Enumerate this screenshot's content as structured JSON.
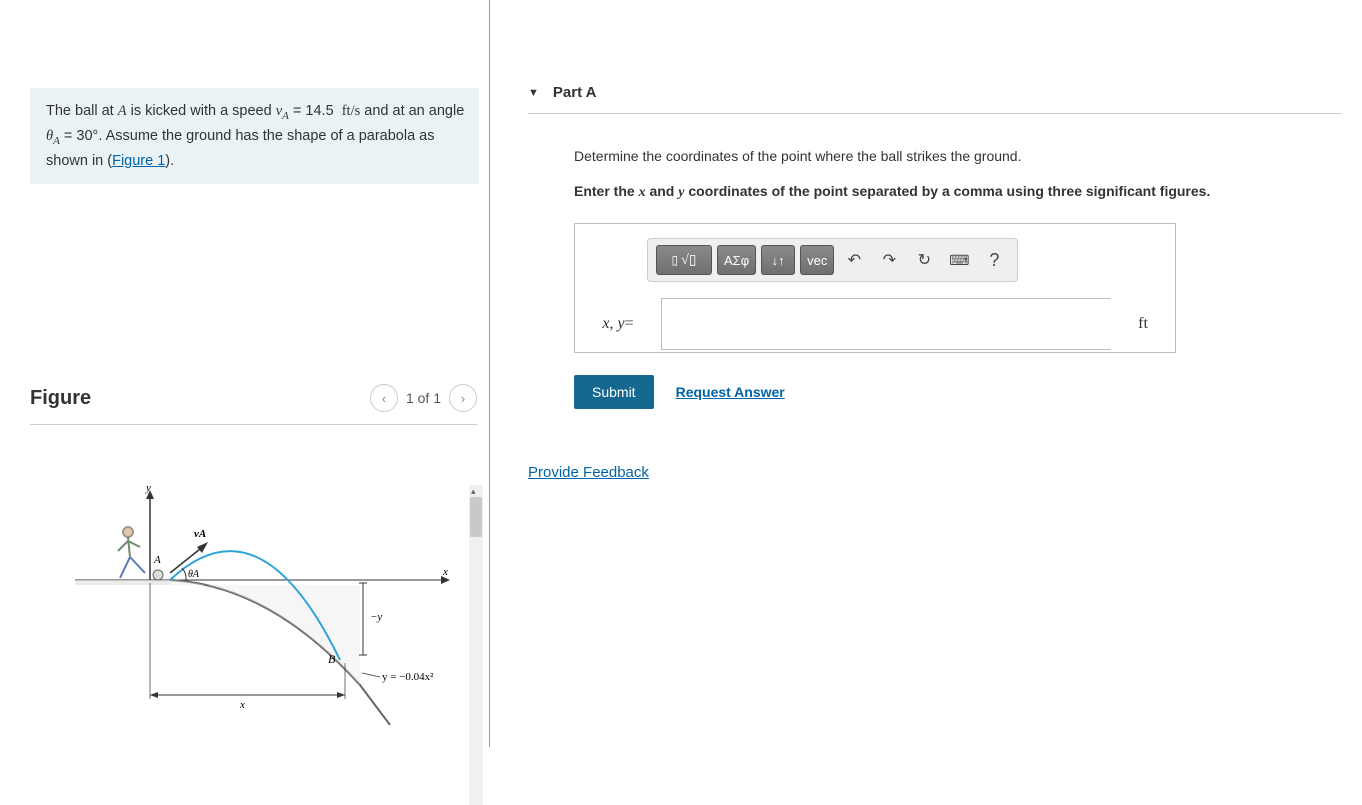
{
  "problem": {
    "speed_value": "14.5",
    "speed_unit": "ft/s",
    "angle_value": "30°",
    "variable_v": "v",
    "subscript_A": "A",
    "variable_theta": "θ",
    "figure_link_text": "Figure 1",
    "text_prefix": "The ball at ",
    "point_A": "A",
    "text_kicked": " is kicked with a speed ",
    "text_and_angle": " and at an angle ",
    "text_assume": ". Assume the ground has the shape of a parabola as shown in (",
    "text_close": ")."
  },
  "figure": {
    "title": "Figure",
    "page_indicator": "1 of 1",
    "labels": {
      "y_axis": "y",
      "x_axis": "x",
      "vA": "vA",
      "A": "A",
      "thetaA": "θA",
      "neg_y": "−y",
      "B": "B",
      "x_dim": "x",
      "equation": "y = −0.04x²"
    }
  },
  "part": {
    "title": "Part A",
    "prompt1": "Determine the coordinates of the point where the ball strikes the ground.",
    "prompt2_prefix": "Enter the ",
    "prompt2_x": "x",
    "prompt2_and": " and ",
    "prompt2_y": "y",
    "prompt2_suffix": " coordinates of the point separated by a comma using three significant figures.",
    "toolbar": {
      "templates_icon": "▯",
      "sqrt_icon": "√▯",
      "greek_icon": "ΑΣφ",
      "subsup_icon": "↓↑",
      "vec_icon": "vec",
      "undo_icon": "↶",
      "redo_icon": "↷",
      "reset_icon": "↻",
      "keyboard_icon": "⌨",
      "help_icon": "?"
    },
    "input_label_x": "x",
    "input_label_y": "y",
    "input_equals": " = ",
    "unit": "ft",
    "submit": "Submit",
    "request": "Request Answer"
  },
  "feedback_link": "Provide Feedback"
}
